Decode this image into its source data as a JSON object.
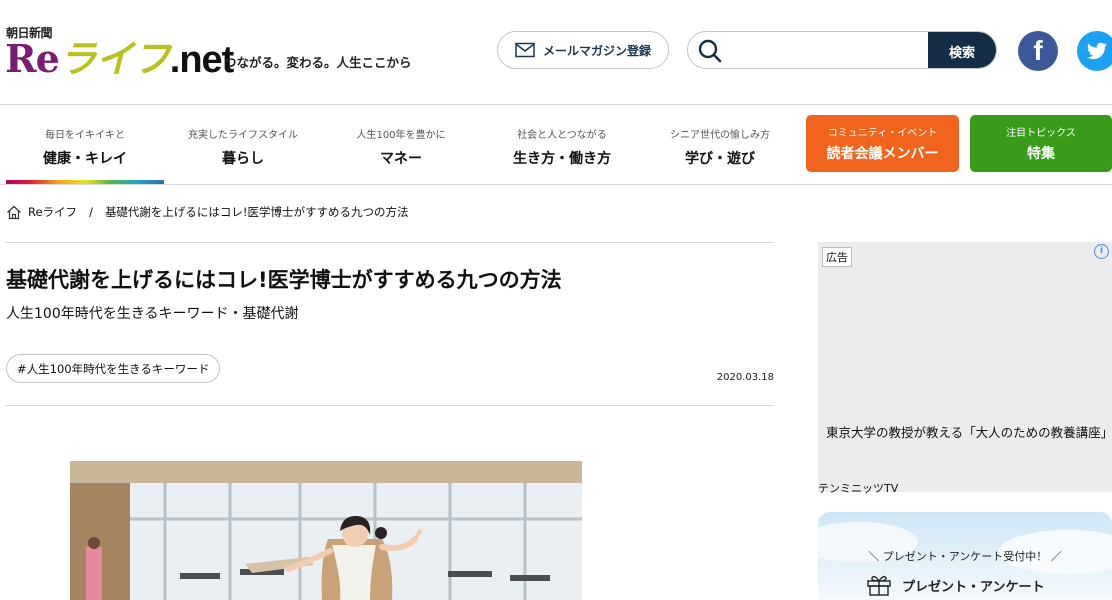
{
  "header": {
    "brand_small": "朝日新聞",
    "logo": {
      "re": "Re",
      "life": "ライフ",
      "net": ".net"
    },
    "tagline": "つながる。変わる。人生ここから",
    "magazine_button": "メールマガジン登録",
    "search": {
      "placeholder": "",
      "button": "検索"
    },
    "facebook_letter": "f"
  },
  "nav": {
    "items": [
      {
        "sub": "毎日をイキイキと",
        "main": "健康・キレイ"
      },
      {
        "sub": "充実したライフスタイル",
        "main": "暮らし"
      },
      {
        "sub": "人生100年を豊かに",
        "main": "マネー"
      },
      {
        "sub": "社会と人とつながる",
        "main": "生き方・働き方"
      },
      {
        "sub": "シニア世代の愉しみ方",
        "main": "学び・遊び"
      }
    ],
    "boxes": [
      {
        "sub": "コミュニティ・イベント",
        "main": "読者会議メンバー",
        "color": "#f0641e"
      },
      {
        "sub": "注目トピックス",
        "main": "特集",
        "color": "#3a9a1a"
      }
    ]
  },
  "breadcrumb": {
    "home": "Reライフ",
    "separator": "/",
    "current": "基礎代謝を上げるにはコレ!医学博士がすすめる九つの方法"
  },
  "article": {
    "title": "基礎代謝を上げるにはコレ!医学博士がすすめる九つの方法",
    "subtitle": "人生100年時代を生きるキーワード・基礎代謝",
    "tag": "#人生100年時代を生きるキーワード",
    "date": "2020.03.18"
  },
  "ad": {
    "label": "広告",
    "info": "i",
    "close": "✕",
    "text": "東京大学の教授が教える「大人のための教養講座」",
    "source": "テンミニッツTV"
  },
  "promo": {
    "line1": "＼ プレゼント・アンケート受付中！ ／",
    "line2": "プレゼント・アンケート"
  },
  "colors": {
    "accent_dark": "#152d45",
    "facebook": "#3b5998",
    "twitter": "#1da1f2",
    "logo_re": "#7a1d72",
    "logo_life": "#b7c21c"
  }
}
